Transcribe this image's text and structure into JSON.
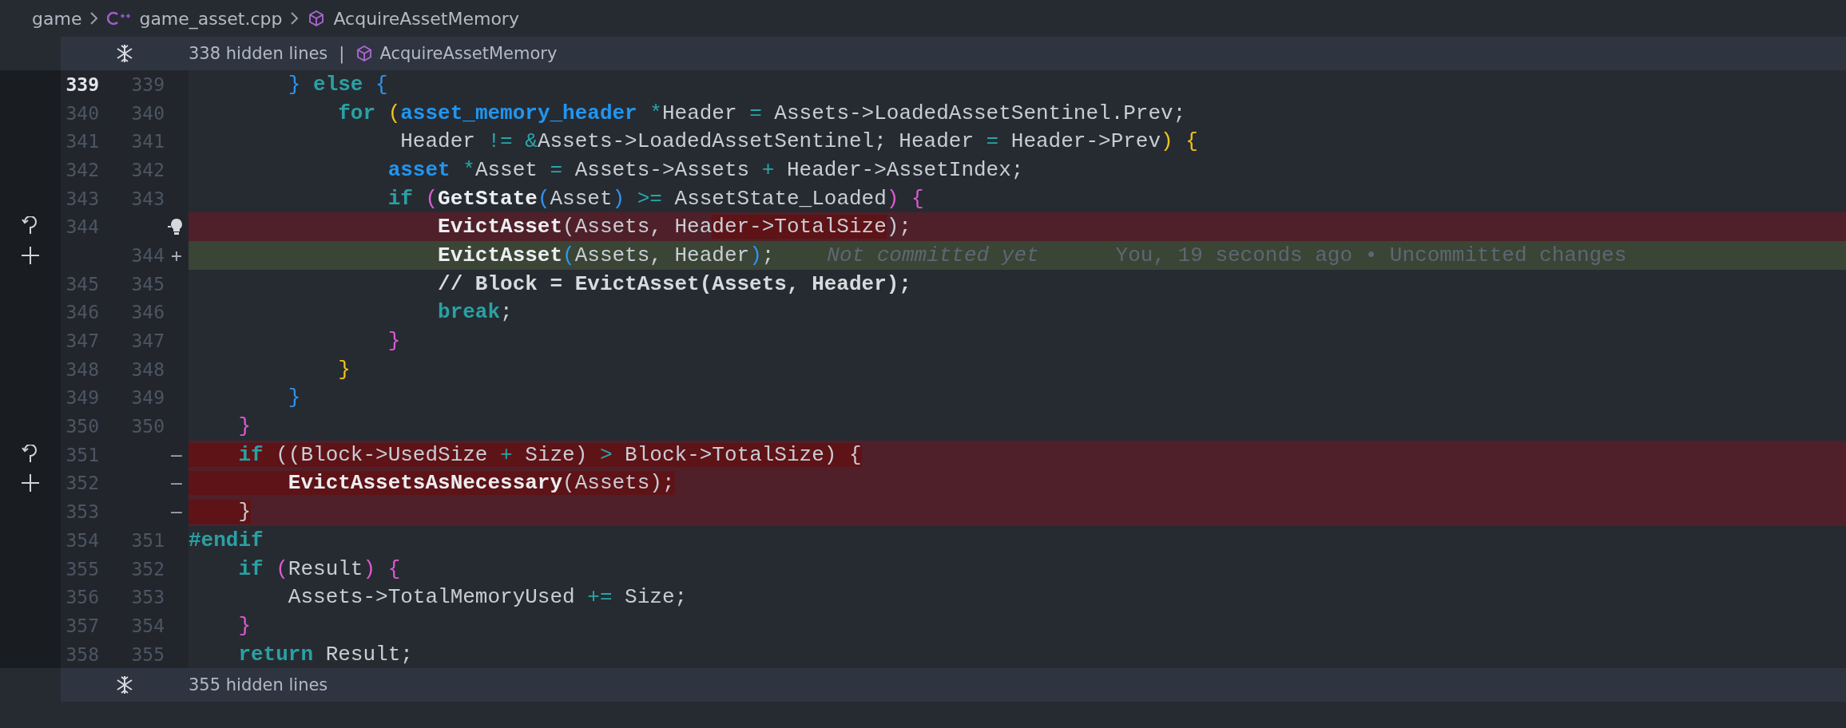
{
  "breadcrumb": {
    "items": [
      {
        "kind": "folder",
        "label": "game"
      },
      {
        "kind": "cpp-file",
        "label": "game_asset.cpp"
      },
      {
        "kind": "symbol",
        "label": "AcquireAssetMemory"
      }
    ]
  },
  "top_fold": {
    "label": "338 hidden lines",
    "separator": "|",
    "symbol": "AcquireAssetMemory"
  },
  "lines": [
    {
      "old": "339",
      "new": "339",
      "kind": "context",
      "current": true,
      "lightbulb": false,
      "code": [
        {
          "kind": "bracket3",
          "text": "        }",
          "changed": false
        },
        {
          "kind": "keyword",
          "text": " else ",
          "changed": false
        },
        {
          "kind": "bracket3",
          "text": "{",
          "changed": false
        }
      ]
    },
    {
      "old": "340",
      "new": "340",
      "kind": "context",
      "current": false,
      "lightbulb": false,
      "code": [
        {
          "kind": "keyword",
          "text": "            for",
          "changed": false
        },
        {
          "kind": "bracket1",
          "text": " (",
          "changed": false
        },
        {
          "kind": "type",
          "text": "asset_memory_header",
          "changed": false
        },
        {
          "kind": "operator",
          "text": " *",
          "changed": false
        },
        {
          "kind": "plain",
          "text": "Header ",
          "changed": false
        },
        {
          "kind": "operator",
          "text": "=",
          "changed": false
        },
        {
          "kind": "plain",
          "text": " Assets->LoadedAssetSentinel.Prev;",
          "changed": false
        }
      ]
    },
    {
      "old": "341",
      "new": "341",
      "kind": "context",
      "current": false,
      "lightbulb": false,
      "code": [
        {
          "kind": "plain",
          "text": "                 Header ",
          "changed": false
        },
        {
          "kind": "operator",
          "text": "!= &",
          "changed": false
        },
        {
          "kind": "plain",
          "text": "Assets->LoadedAssetSentinel; Header ",
          "changed": false
        },
        {
          "kind": "operator",
          "text": "=",
          "changed": false
        },
        {
          "kind": "plain",
          "text": " Header->Prev",
          "changed": false
        },
        {
          "kind": "bracket1",
          "text": ") {",
          "changed": false
        }
      ]
    },
    {
      "old": "342",
      "new": "342",
      "kind": "context",
      "current": false,
      "lightbulb": false,
      "code": [
        {
          "kind": "type",
          "text": "                asset",
          "changed": false
        },
        {
          "kind": "operator",
          "text": " *",
          "changed": false
        },
        {
          "kind": "plain",
          "text": "Asset ",
          "changed": false
        },
        {
          "kind": "operator",
          "text": "=",
          "changed": false
        },
        {
          "kind": "plain",
          "text": " Assets->Assets ",
          "changed": false
        },
        {
          "kind": "operator",
          "text": "+",
          "changed": false
        },
        {
          "kind": "plain",
          "text": " Header->AssetIndex;",
          "changed": false
        }
      ]
    },
    {
      "old": "343",
      "new": "343",
      "kind": "context",
      "current": false,
      "lightbulb": false,
      "code": [
        {
          "kind": "keyword",
          "text": "                if",
          "changed": false
        },
        {
          "kind": "bracket2",
          "text": " (",
          "changed": false
        },
        {
          "kind": "function",
          "text": "GetState",
          "changed": false
        },
        {
          "kind": "bracket3",
          "text": "(",
          "changed": false
        },
        {
          "kind": "plain",
          "text": "Asset",
          "changed": false
        },
        {
          "kind": "bracket3",
          "text": ")",
          "changed": false
        },
        {
          "kind": "operator",
          "text": " >=",
          "changed": false
        },
        {
          "kind": "plain",
          "text": " AssetState_Loaded",
          "changed": false
        },
        {
          "kind": "bracket2",
          "text": ") {",
          "changed": false
        }
      ]
    },
    {
      "old": "344",
      "kind": "removed",
      "current": false,
      "lightbulb": true,
      "revert": true,
      "stage": false,
      "code": [
        {
          "kind": "function",
          "text": "                    EvictAsset",
          "changed": false
        },
        {
          "kind": "plain",
          "text": "(Assets, Hea",
          "changed": false
        },
        {
          "kind": "plain",
          "text": "der->TotalSize",
          "changed": true
        },
        {
          "kind": "plain",
          "text": ");",
          "changed": false
        }
      ]
    },
    {
      "new": "344",
      "kind": "added",
      "marker": "+",
      "current": false,
      "lightbulb": false,
      "revert": false,
      "stage": true,
      "code": [
        {
          "kind": "function",
          "text": "                    EvictAsset",
          "changed": false
        },
        {
          "kind": "bracket3",
          "text": "(",
          "changed": false
        },
        {
          "kind": "plain",
          "text": "Assets, Header",
          "changed": false
        },
        {
          "kind": "bracket3",
          "text": ")",
          "changed": false
        },
        {
          "kind": "plain",
          "text": ";",
          "changed": false
        }
      ],
      "blame": {
        "message": "Not committed yet",
        "details": "You, 19 seconds ago • Uncommitted changes"
      }
    },
    {
      "old": "345",
      "new": "345",
      "kind": "context",
      "current": false,
      "lightbulb": false,
      "code": [
        {
          "kind": "comment",
          "text": "                    // Block = EvictAsset(Assets, Header);",
          "changed": false
        }
      ]
    },
    {
      "old": "346",
      "new": "346",
      "kind": "context",
      "current": false,
      "lightbulb": false,
      "code": [
        {
          "kind": "keyword",
          "text": "                    break",
          "changed": false
        },
        {
          "kind": "plain",
          "text": ";",
          "changed": false
        }
      ]
    },
    {
      "old": "347",
      "new": "347",
      "kind": "context",
      "current": false,
      "lightbulb": false,
      "code": [
        {
          "kind": "bracket2",
          "text": "                }",
          "changed": false
        }
      ]
    },
    {
      "old": "348",
      "new": "348",
      "kind": "context",
      "current": false,
      "lightbulb": false,
      "code": [
        {
          "kind": "bracket1",
          "text": "            }",
          "changed": false
        }
      ]
    },
    {
      "old": "349",
      "new": "349",
      "kind": "context",
      "current": false,
      "lightbulb": false,
      "code": [
        {
          "kind": "bracket3",
          "text": "        }",
          "changed": false
        }
      ]
    },
    {
      "old": "350",
      "new": "350",
      "kind": "context",
      "current": false,
      "lightbulb": false,
      "code": [
        {
          "kind": "bracket2",
          "text": "    }",
          "changed": false
        }
      ]
    },
    {
      "old": "351",
      "kind": "removed",
      "marker": "—",
      "current": false,
      "lightbulb": false,
      "revert": true,
      "stage": false,
      "code": [
        {
          "kind": "keyword",
          "text": "    if",
          "changed": true
        },
        {
          "kind": "plain",
          "text": " ((Block->UsedSize ",
          "changed": true
        },
        {
          "kind": "operator",
          "text": "+",
          "changed": true
        },
        {
          "kind": "plain",
          "text": " Size) ",
          "changed": true
        },
        {
          "kind": "operator",
          "text": ">",
          "changed": true
        },
        {
          "kind": "plain",
          "text": " Block->TotalSize) {",
          "changed": true
        }
      ]
    },
    {
      "old": "352",
      "kind": "removed",
      "marker": "—",
      "current": false,
      "lightbulb": false,
      "revert": false,
      "stage": true,
      "code": [
        {
          "kind": "function",
          "text": "        EvictAssetsAsNecessary",
          "changed": true
        },
        {
          "kind": "plain",
          "text": "(Assets);",
          "changed": true
        }
      ]
    },
    {
      "old": "353",
      "kind": "removed",
      "marker": "—",
      "current": false,
      "lightbulb": false,
      "code": [
        {
          "kind": "plain",
          "text": "    }",
          "changed": true
        }
      ]
    },
    {
      "old": "354",
      "new": "351",
      "kind": "context",
      "current": false,
      "lightbulb": false,
      "code": [
        {
          "kind": "keyword",
          "text": "#endif",
          "changed": false
        }
      ]
    },
    {
      "old": "355",
      "new": "352",
      "kind": "context",
      "current": false,
      "lightbulb": false,
      "code": [
        {
          "kind": "keyword",
          "text": "    if",
          "changed": false
        },
        {
          "kind": "bracket2",
          "text": " (",
          "changed": false
        },
        {
          "kind": "plain",
          "text": "Result",
          "changed": false
        },
        {
          "kind": "bracket2",
          "text": ") {",
          "changed": false
        }
      ]
    },
    {
      "old": "356",
      "new": "353",
      "kind": "context",
      "current": false,
      "lightbulb": false,
      "code": [
        {
          "kind": "plain",
          "text": "        Assets->TotalMemoryUsed ",
          "changed": false
        },
        {
          "kind": "operator",
          "text": "+=",
          "changed": false
        },
        {
          "kind": "plain",
          "text": " Size;",
          "changed": false
        }
      ]
    },
    {
      "old": "357",
      "new": "354",
      "kind": "context",
      "current": false,
      "lightbulb": false,
      "code": [
        {
          "kind": "bracket2",
          "text": "    }",
          "changed": false
        }
      ]
    },
    {
      "old": "358",
      "new": "355",
      "kind": "context",
      "current": false,
      "lightbulb": false,
      "code": [
        {
          "kind": "keyword",
          "text": "    return",
          "changed": false
        },
        {
          "kind": "plain",
          "text": " Result;",
          "changed": false
        }
      ]
    }
  ],
  "bottom_fold": {
    "label": "355 hidden lines"
  }
}
